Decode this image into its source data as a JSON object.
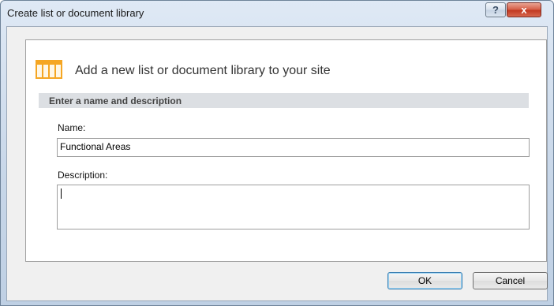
{
  "window": {
    "title": "Create list or document library",
    "help_label": "?",
    "close_label": "x"
  },
  "header": {
    "icon": "list-icon",
    "text": "Add a new list or document library to your site"
  },
  "section": {
    "title": "Enter a name and description"
  },
  "fields": {
    "name_label": "Name:",
    "name_value": "Functional Areas",
    "description_label": "Description:",
    "description_value": ""
  },
  "buttons": {
    "ok_label": "OK",
    "cancel_label": "Cancel"
  },
  "colors": {
    "icon_orange": "#f5a623",
    "section_bar": "#dcdfe3",
    "close_red": "#c23a22"
  }
}
